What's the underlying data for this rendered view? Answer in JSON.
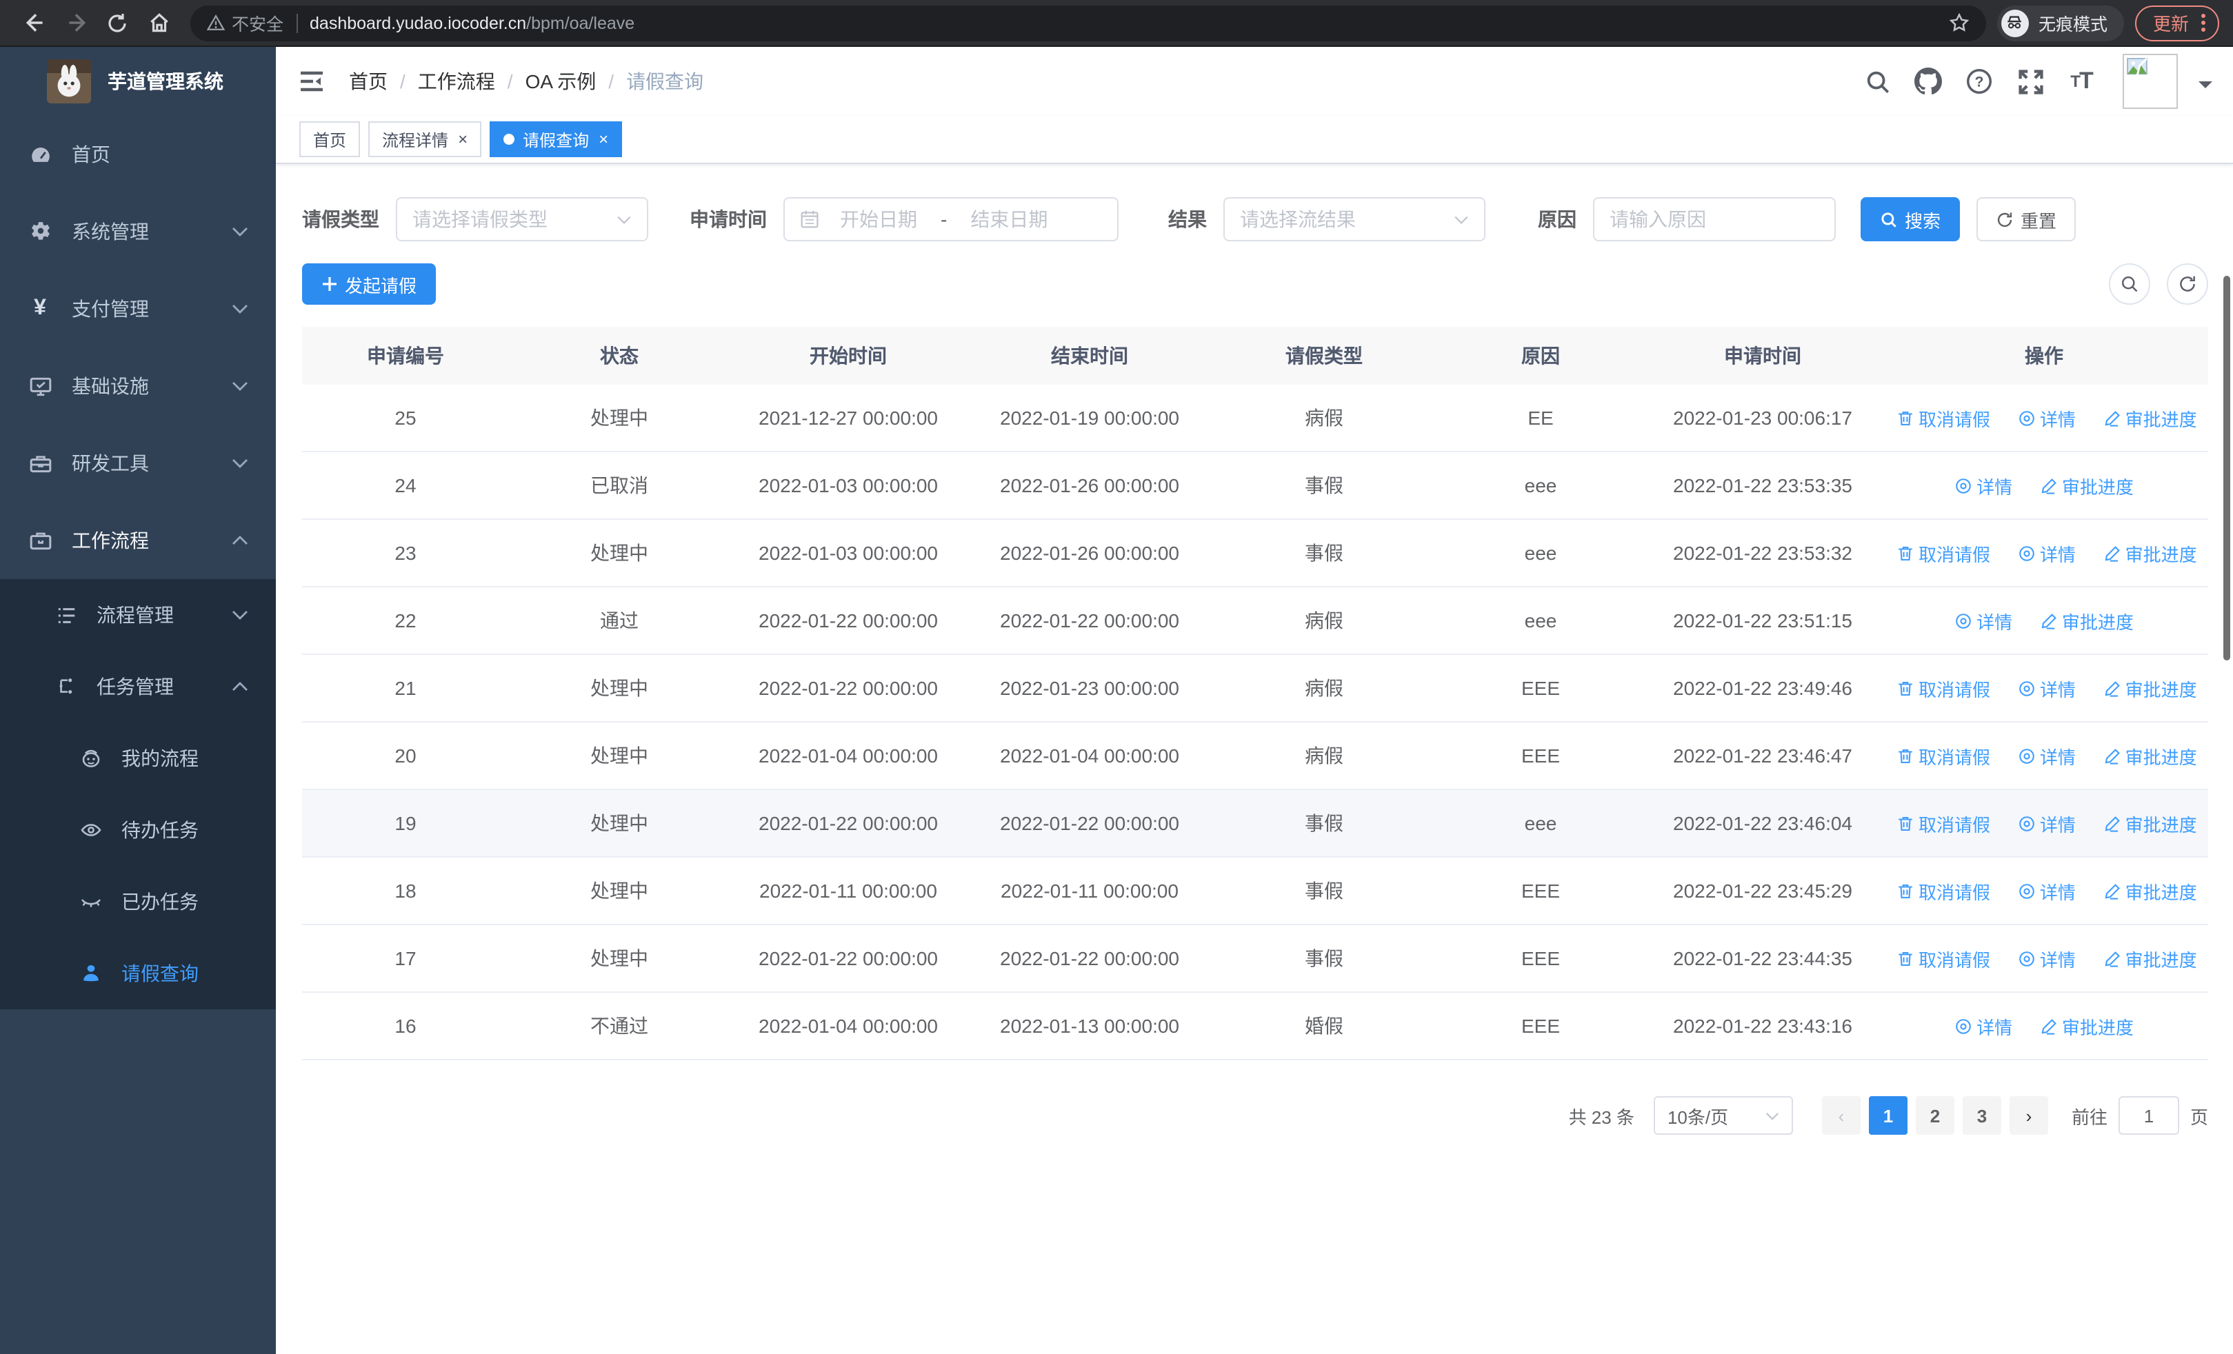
{
  "browser": {
    "security_label": "不安全",
    "url_host": "dashboard.yudao.iocoder.cn",
    "url_path": "/bpm/oa/leave",
    "incognito_label": "无痕模式",
    "update_label": "更新"
  },
  "sidebar": {
    "title": "芋道管理系统",
    "items": [
      {
        "label": "首页"
      },
      {
        "label": "系统管理"
      },
      {
        "label": "支付管理"
      },
      {
        "label": "基础设施"
      },
      {
        "label": "研发工具"
      },
      {
        "label": "工作流程"
      }
    ],
    "workflow_children": [
      {
        "label": "流程管理"
      },
      {
        "label": "任务管理"
      }
    ],
    "task_children": [
      {
        "label": "我的流程"
      },
      {
        "label": "待办任务"
      },
      {
        "label": "已办任务"
      },
      {
        "label": "请假查询"
      }
    ]
  },
  "header": {
    "breadcrumb": [
      "首页",
      "工作流程",
      "OA 示例",
      "请假查询"
    ],
    "separator": "/"
  },
  "tabs": {
    "items": [
      {
        "label": "首页"
      },
      {
        "label": "流程详情"
      },
      {
        "label": "请假查询"
      }
    ],
    "close_glyph": "×"
  },
  "filters": {
    "leave_type": {
      "label": "请假类型",
      "placeholder": "请选择请假类型"
    },
    "apply_time": {
      "label": "申请时间",
      "start_placeholder": "开始日期",
      "separator": "-",
      "end_placeholder": "结束日期"
    },
    "result": {
      "label": "结果",
      "placeholder": "请选择流结果"
    },
    "reason": {
      "label": "原因",
      "placeholder": "请输入原因"
    },
    "search_label": "搜索",
    "reset_label": "重置"
  },
  "toolbar": {
    "create_label": "发起请假"
  },
  "table": {
    "columns": [
      "申请编号",
      "状态",
      "开始时间",
      "结束时间",
      "请假类型",
      "原因",
      "申请时间",
      "操作"
    ],
    "action_defs": {
      "cancel": "取消请假",
      "detail": "详情",
      "progress": "审批进度"
    },
    "rows": [
      {
        "id": "25",
        "status": "处理中",
        "start": "2021-12-27 00:00:00",
        "end": "2022-01-19 00:00:00",
        "type": "病假",
        "reason": "EE",
        "applied": "2022-01-23 00:06:17",
        "actions": [
          "cancel",
          "detail",
          "progress"
        ]
      },
      {
        "id": "24",
        "status": "已取消",
        "start": "2022-01-03 00:00:00",
        "end": "2022-01-26 00:00:00",
        "type": "事假",
        "reason": "eee",
        "applied": "2022-01-22 23:53:35",
        "actions": [
          "detail",
          "progress"
        ]
      },
      {
        "id": "23",
        "status": "处理中",
        "start": "2022-01-03 00:00:00",
        "end": "2022-01-26 00:00:00",
        "type": "事假",
        "reason": "eee",
        "applied": "2022-01-22 23:53:32",
        "actions": [
          "cancel",
          "detail",
          "progress"
        ]
      },
      {
        "id": "22",
        "status": "通过",
        "start": "2022-01-22 00:00:00",
        "end": "2022-01-22 00:00:00",
        "type": "病假",
        "reason": "eee",
        "applied": "2022-01-22 23:51:15",
        "actions": [
          "detail",
          "progress"
        ]
      },
      {
        "id": "21",
        "status": "处理中",
        "start": "2022-01-22 00:00:00",
        "end": "2022-01-23 00:00:00",
        "type": "病假",
        "reason": "EEE",
        "applied": "2022-01-22 23:49:46",
        "actions": [
          "cancel",
          "detail",
          "progress"
        ]
      },
      {
        "id": "20",
        "status": "处理中",
        "start": "2022-01-04 00:00:00",
        "end": "2022-01-04 00:00:00",
        "type": "病假",
        "reason": "EEE",
        "applied": "2022-01-22 23:46:47",
        "actions": [
          "cancel",
          "detail",
          "progress"
        ]
      },
      {
        "id": "19",
        "status": "处理中",
        "start": "2022-01-22 00:00:00",
        "end": "2022-01-22 00:00:00",
        "type": "事假",
        "reason": "eee",
        "applied": "2022-01-22 23:46:04",
        "actions": [
          "cancel",
          "detail",
          "progress"
        ],
        "highlight": true
      },
      {
        "id": "18",
        "status": "处理中",
        "start": "2022-01-11 00:00:00",
        "end": "2022-01-11 00:00:00",
        "type": "事假",
        "reason": "EEE",
        "applied": "2022-01-22 23:45:29",
        "actions": [
          "cancel",
          "detail",
          "progress"
        ]
      },
      {
        "id": "17",
        "status": "处理中",
        "start": "2022-01-22 00:00:00",
        "end": "2022-01-22 00:00:00",
        "type": "事假",
        "reason": "EEE",
        "applied": "2022-01-22 23:44:35",
        "actions": [
          "cancel",
          "detail",
          "progress"
        ]
      },
      {
        "id": "16",
        "status": "不通过",
        "start": "2022-01-04 00:00:00",
        "end": "2022-01-13 00:00:00",
        "type": "婚假",
        "reason": "EEE",
        "applied": "2022-01-22 23:43:16",
        "actions": [
          "detail",
          "progress"
        ]
      }
    ]
  },
  "pagination": {
    "total_label": "共 23 条",
    "page_size_label": "10条/页",
    "prev_glyph": "‹",
    "next_glyph": "›",
    "pages": [
      "1",
      "2",
      "3"
    ],
    "active_page": "1",
    "goto_label": "前往",
    "goto_value": "1",
    "unit_label": "页"
  }
}
